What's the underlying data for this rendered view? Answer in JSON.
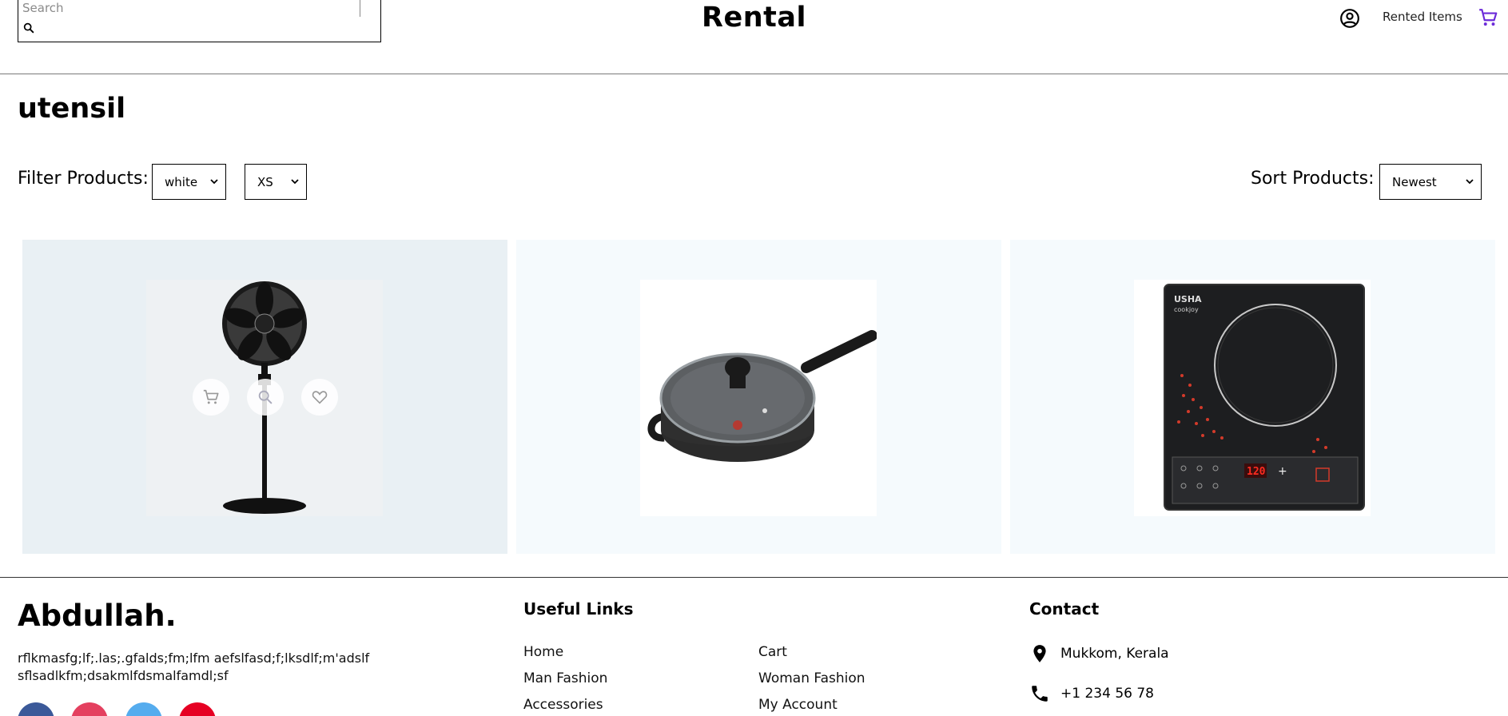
{
  "header": {
    "search_placeholder": "Search",
    "brand": "Rental",
    "rented_items_label": "Rented Items",
    "icons": [
      "search-icon",
      "account-icon",
      "cart-icon"
    ]
  },
  "page_title": "utensil",
  "filters": {
    "label": "Filter Products:",
    "color_selected": "white",
    "size_selected": "XS",
    "sort_label": "Sort Products:",
    "sort_selected": "Newest"
  },
  "products": [
    {
      "name": "pedestal-fan",
      "hovered": true,
      "actions": [
        "cart-icon",
        "search-icon",
        "heart-icon"
      ]
    },
    {
      "name": "frying-pan",
      "hovered": false
    },
    {
      "name": "induction-cooktop",
      "hovered": false,
      "display_value": "120",
      "brand_text": "USHA",
      "model_text": "cookjoy"
    }
  ],
  "footer": {
    "brand": "Abdullah.",
    "description": "rflkmasfg;lf;.las;.gfalds;fm;lfm aefslfasd;f;lksdlf;m'adslf sflsadlkfm;dsakmlfdsmalfamdl;sf",
    "useful_links_title": "Useful Links",
    "links": [
      "Home",
      "Cart",
      "Man Fashion",
      "Woman Fashion",
      "Accessories",
      "My Account"
    ],
    "contact_title": "Contact",
    "address": "Mukkom, Kerala",
    "phone": "+1 234 56 78",
    "social": [
      "facebook-icon",
      "instagram-icon",
      "twitter-icon",
      "pinterest-icon"
    ]
  },
  "colors": {
    "product_bg": "#f5fafd",
    "product_bg_hover": "#e9f0f4",
    "cart_accent": "#6c2bd9",
    "facebook": "#3b5999",
    "instagram": "#e4405f",
    "twitter": "#55acee",
    "pinterest": "#e60023"
  }
}
